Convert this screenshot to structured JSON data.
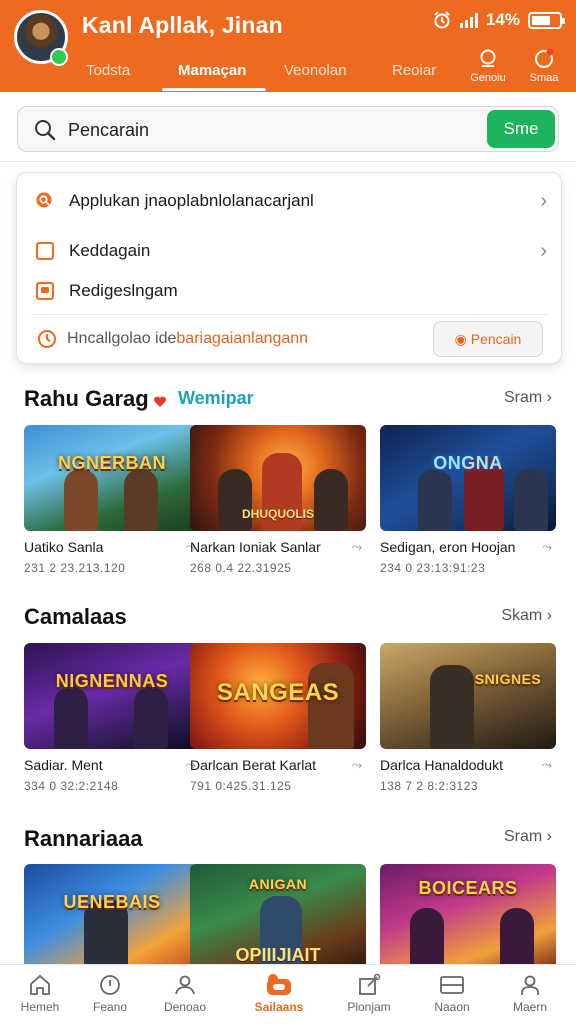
{
  "header": {
    "title": "Kanl Apllak, Jinan",
    "status": {
      "battery_percent": "14%",
      "battery_level": 0.7
    },
    "tabs": [
      {
        "label": "Todsta",
        "active": false
      },
      {
        "label": "Mamaçan",
        "active": true
      },
      {
        "label": "Veonolan",
        "active": false
      },
      {
        "label": "Reoiar",
        "active": false
      }
    ],
    "actions": [
      {
        "label": "Genoiu",
        "icon": "search-icon"
      },
      {
        "label": "Smaa",
        "icon": "notification-icon"
      }
    ]
  },
  "search": {
    "placeholder": "Pencarain",
    "button_label": "Sme"
  },
  "dropdown": {
    "items": [
      {
        "label": "Applukan jnaoplabnlolanacarjanl",
        "icon": "search-suggestion-icon"
      },
      {
        "label": "Keddagain",
        "icon": "checkbox-icon"
      },
      {
        "label": "Redigeslngam",
        "icon": "list-icon"
      }
    ],
    "footer_label_prefix": "Hncallgolao ide",
    "footer_label_highlight": "bariagaianlangann",
    "footer_button": "Pencain"
  },
  "sections": [
    {
      "title": "Rahu Garag",
      "tag": "Wemipar",
      "see_all": "Sram",
      "cards": [
        {
          "thumb_title": "NGNERBAN",
          "thumb_sub": "",
          "name": "Uatiko Sanla",
          "meta": "231 2 23.213.120"
        },
        {
          "thumb_title": "",
          "thumb_sub": "DHUQUOLIS",
          "name": "Narkan Ioniak Sanlar",
          "meta": "268 0.4 22.31925"
        },
        {
          "thumb_title": "ONGNA",
          "thumb_sub": "",
          "name": "Sedigan, eron Hoojan",
          "meta": "234 0 23:13:91:23"
        }
      ]
    },
    {
      "title": "Camalaas",
      "tag": "",
      "see_all": "Skam",
      "cards": [
        {
          "thumb_title": "NIGNENNAS",
          "thumb_sub": "",
          "name": "Sadiar. Ment",
          "meta": "334 0 32:2:2148"
        },
        {
          "thumb_title": "SANGEAS",
          "thumb_sub": "",
          "name": "Darlcan Berat Karlat",
          "meta": "791 0:425.31.125"
        },
        {
          "thumb_title": "SNIGNES",
          "thumb_sub": "",
          "name": "Darlca Hanaldodukt",
          "meta": "138 7 2 8:2:3123"
        }
      ]
    },
    {
      "title": "Rannariaaa",
      "tag": "",
      "see_all": "Sram",
      "cards": [
        {
          "thumb_title": "UENEBAIS",
          "thumb_sub": "",
          "name": "",
          "meta": ""
        },
        {
          "thumb_title": "ANIGAN",
          "thumb_sub": "OPIIIJIAIT",
          "name": "",
          "meta": ""
        },
        {
          "thumb_title": "BOICEARS",
          "thumb_sub": "",
          "name": "",
          "meta": ""
        }
      ]
    }
  ],
  "bottom_nav": [
    {
      "label": "Hemeh",
      "icon": "home-icon",
      "active": false
    },
    {
      "label": "Feano",
      "icon": "compass-icon",
      "active": false
    },
    {
      "label": "Denoao",
      "icon": "profile-icon",
      "active": false
    },
    {
      "label": "Sailaans",
      "icon": "game-controller-icon",
      "active": true
    },
    {
      "label": "Plonjam",
      "icon": "edit-icon",
      "active": false
    },
    {
      "label": "Naaon",
      "icon": "inbox-icon",
      "active": false
    },
    {
      "label": "Maern",
      "icon": "user-icon",
      "active": false
    }
  ],
  "colors": {
    "brand": "#ee6a1f",
    "action": "#1db35c",
    "tag": "#17a5b8"
  }
}
